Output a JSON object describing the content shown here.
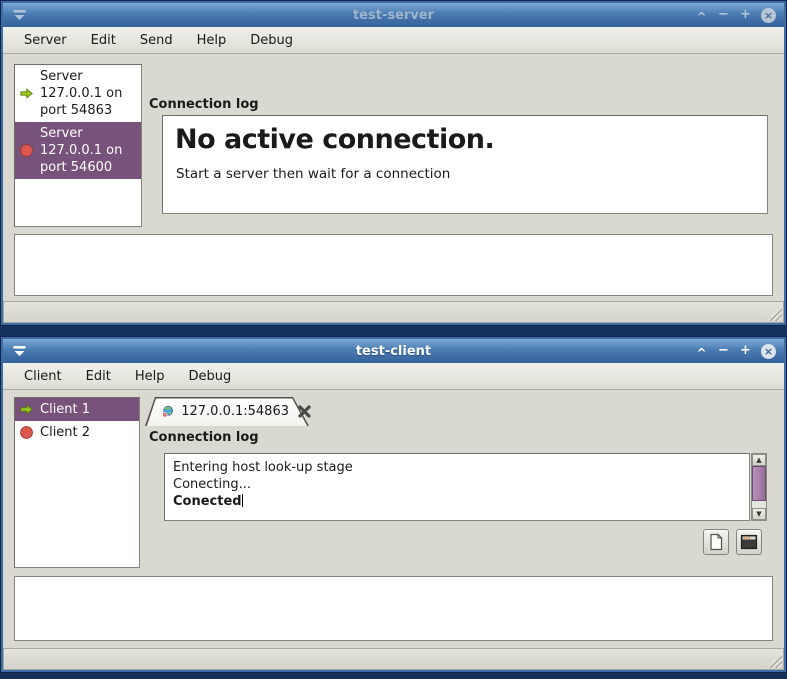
{
  "server_window": {
    "title": "test-server",
    "controls": {
      "shade": "^",
      "minimize": "−",
      "maximize": "+",
      "close": "×"
    },
    "menu": [
      "Server",
      "Edit",
      "Send",
      "Help",
      "Debug"
    ],
    "server_list": [
      {
        "status": "running",
        "label": "Server\n127.0.0.1 on\nport 54863"
      },
      {
        "status": "stopped",
        "label": "Server\n127.0.0.1 on\nport 54600"
      }
    ],
    "log_section_label": "Connection log",
    "log_heading": "No active connection.",
    "log_message": "Start a server then wait for a connection",
    "message_input_value": ""
  },
  "client_window": {
    "title": "test-client",
    "controls": {
      "shade": "^",
      "minimize": "−",
      "maximize": "+",
      "close": "×"
    },
    "menu": [
      "Client",
      "Edit",
      "Help",
      "Debug"
    ],
    "client_list": [
      {
        "status": "running",
        "label": "Client 1"
      },
      {
        "status": "stopped",
        "label": "Client 2"
      }
    ],
    "tab": {
      "label": "127.0.0.1:54863"
    },
    "log_section_label": "Connection log",
    "log_lines": [
      "Entering host look-up stage",
      "Conecting...",
      "Conected"
    ],
    "message_input_value": ""
  },
  "colors": {
    "titlebar_blue": "#4a7cb2",
    "selection_purple": "#77527b",
    "scrollbar_thumb_purple": "#a780ab",
    "running_green": "#9ac61d",
    "stopped_red": "#dd584e",
    "desktop_navy": "#16305c"
  }
}
